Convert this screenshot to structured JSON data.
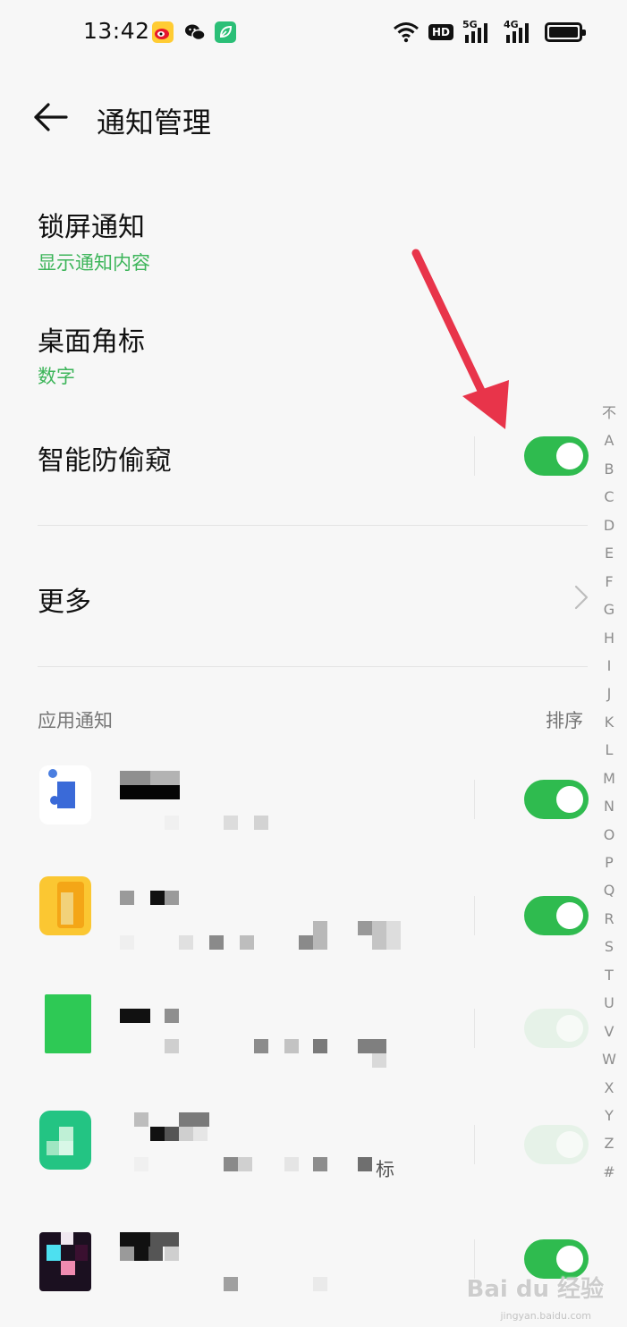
{
  "status_bar": {
    "time": "13:42",
    "hd_label": "HD",
    "signal1_label": "5G",
    "signal2_label": "4G",
    "icons": [
      "weibo-icon",
      "wechat-icon",
      "leaf-app-icon",
      "wifi-icon",
      "hd-icon",
      "signal-5g-icon",
      "signal-4g-icon",
      "battery-icon"
    ]
  },
  "header": {
    "title": "通知管理",
    "back_icon": "back-arrow-icon"
  },
  "settings": {
    "lock_screen": {
      "title": "锁屏通知",
      "value": "显示通知内容"
    },
    "badge": {
      "title": "桌面角标",
      "value": "数字"
    },
    "privacy": {
      "title": "智能防偷窥",
      "enabled": true
    },
    "more": {
      "title": "更多"
    }
  },
  "app_section": {
    "label": "应用通知",
    "sort_label": "排序",
    "apps": [
      {
        "enabled": true
      },
      {
        "enabled": true
      },
      {
        "enabled": true,
        "dimmed": true
      },
      {
        "enabled": true,
        "dimmed": true,
        "visible_fragment": "标"
      },
      {
        "enabled": true
      }
    ]
  },
  "alpha_index": [
    "不",
    "A",
    "B",
    "C",
    "D",
    "E",
    "F",
    "G",
    "H",
    "I",
    "J",
    "K",
    "L",
    "M",
    "N",
    "O",
    "P",
    "Q",
    "R",
    "S",
    "T",
    "U",
    "V",
    "W",
    "X",
    "Y",
    "Z",
    "#"
  ],
  "colors": {
    "accent_green": "#2fbb4f",
    "subtitle_green": "#3db55a",
    "annotation_arrow": "#e8344a"
  },
  "watermark": {
    "text": "Bai du 经验",
    "url": "jingyan.baidu.com"
  }
}
